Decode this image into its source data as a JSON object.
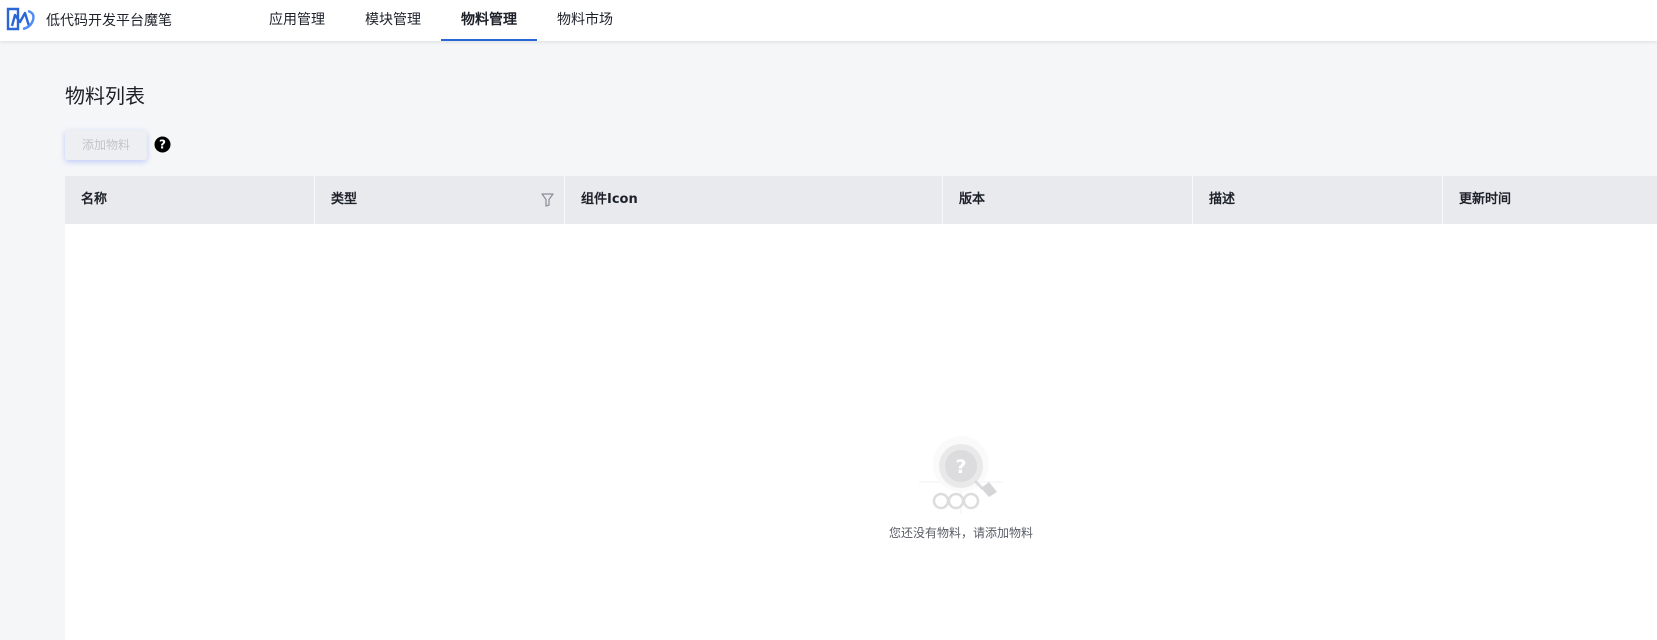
{
  "brand": {
    "title": "低代码开发平台魔笔"
  },
  "nav": {
    "items": [
      {
        "label": "应用管理"
      },
      {
        "label": "模块管理"
      },
      {
        "label": "物料管理",
        "active": true
      },
      {
        "label": "物料市场"
      }
    ]
  },
  "page": {
    "title": "物料列表",
    "add_button": "添加物料"
  },
  "table": {
    "columns": [
      {
        "label": "名称"
      },
      {
        "label": "类型"
      },
      {
        "label": "组件Icon"
      },
      {
        "label": "版本"
      },
      {
        "label": "描述"
      },
      {
        "label": "更新时间"
      }
    ],
    "rows": [],
    "empty_text": "您还没有物料，请添加物料"
  },
  "colors": {
    "accent": "#2a66d6",
    "background": "#f5f6f8",
    "header_bg": "#e9eaee"
  },
  "icons": [
    "logo-icon",
    "help-icon",
    "filter-icon",
    "empty-state-icon"
  ]
}
